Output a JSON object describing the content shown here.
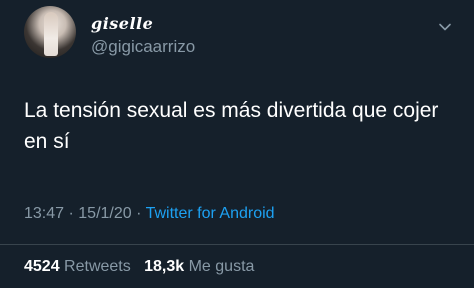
{
  "author": {
    "display_name": "giselle",
    "handle": "@gigicaarrizo"
  },
  "tweet": {
    "text": "La tensión sexual es más divertida que cojer en sí"
  },
  "meta": {
    "time": "13:47",
    "separator1": " · ",
    "date": "15/1/20",
    "separator2": " · ",
    "source": "Twitter for Android"
  },
  "stats": {
    "retweets_count": "4524",
    "retweets_label": "Retweets",
    "likes_count": "18,3k",
    "likes_label": "Me gusta"
  },
  "icons": {
    "menu": "chevron-down-icon"
  },
  "colors": {
    "background": "#15202b",
    "secondary_text": "#8899a6",
    "link": "#1da1f2",
    "divider": "#38444d"
  }
}
